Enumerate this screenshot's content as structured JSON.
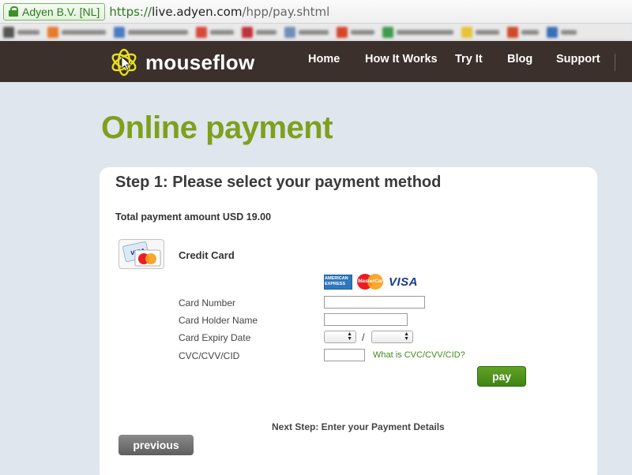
{
  "browser": {
    "identity": "Adyen B.V. [NL]",
    "url_protocol": "https://",
    "url_host": "live.adyen.com",
    "url_path": "/hpp/pay.shtml"
  },
  "header": {
    "logo_text": "mouseflow",
    "nav": [
      {
        "label": "Home"
      },
      {
        "label": "How It Works"
      },
      {
        "label": "Try It"
      },
      {
        "label": "Blog"
      },
      {
        "label": "Support"
      }
    ]
  },
  "page": {
    "title": "Online payment",
    "step_title": "Step 1: Please select your payment method",
    "total": "Total payment amount USD 19.00"
  },
  "payment_method": {
    "label": "Credit Card",
    "brands": [
      "AMERICAN EXPRESS",
      "MasterCard",
      "VISA"
    ],
    "fields": [
      {
        "label": "Card Number",
        "value": ""
      },
      {
        "label": "Card Holder Name",
        "value": ""
      },
      {
        "label": "Card Expiry Date",
        "month": "",
        "year": ""
      },
      {
        "label": "CVC/CVV/CID",
        "value": ""
      }
    ],
    "expiry_separator": "/",
    "help_link": "What is CVC/CVV/CID?",
    "pay_button": "pay"
  },
  "footer": {
    "next_step": "Next Step: Enter your Payment Details",
    "previous_button": "previous"
  },
  "colors": {
    "brand_green": "#7ea01c",
    "header_brown": "#3b302b",
    "pay_green": "#4f9320",
    "link_green": "#3f8a1c"
  }
}
